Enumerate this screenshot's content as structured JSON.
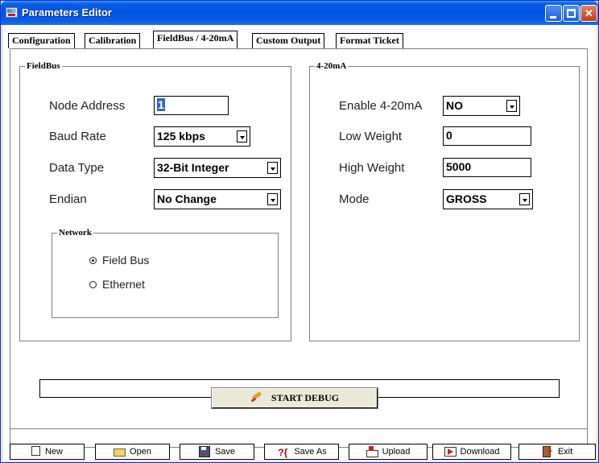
{
  "window": {
    "title": "Parameters Editor",
    "controls": {
      "minimize": "",
      "maximize": "",
      "close": "✕"
    }
  },
  "tabs": [
    {
      "label": "Configuration",
      "mnemonic_index": 3
    },
    {
      "label": "Calibration",
      "mnemonic_index": 6
    },
    {
      "label": "FieldBus / 4-20mA",
      "active": true
    },
    {
      "label": "Custom Output"
    },
    {
      "label": "Format Ticket"
    }
  ],
  "fieldbus": {
    "group_label": "FieldBus",
    "node_address": {
      "label": "Node Address",
      "value": "1"
    },
    "baud_rate": {
      "label": "Baud Rate",
      "value": "125 kbps"
    },
    "data_type": {
      "label": "Data Type",
      "value": "32-Bit Integer"
    },
    "endian": {
      "label": "Endian",
      "value": "No Change"
    },
    "network": {
      "group_label": "Network",
      "options": [
        {
          "label": "Field Bus",
          "selected": true
        },
        {
          "label": "Ethernet",
          "selected": false
        }
      ]
    }
  },
  "analog": {
    "group_label": "4-20mA",
    "enable": {
      "label": "Enable 4-20mA",
      "value": "NO"
    },
    "low_weight": {
      "label": "Low Weight",
      "value": "0"
    },
    "high_weight": {
      "label": "High Weight",
      "value": "5000"
    },
    "mode": {
      "label": "Mode",
      "value": "GROSS"
    }
  },
  "status_field": {
    "value": ""
  },
  "debug_button": {
    "label": "START DEBUG",
    "icon": "debug-icon"
  },
  "bottom_buttons": [
    {
      "label": "New",
      "icon": "new-file-icon"
    },
    {
      "label": "Open",
      "icon": "open-folder-icon"
    },
    {
      "label": "Save",
      "icon": "save-icon"
    },
    {
      "label": "Save As",
      "icon": "save-as-icon"
    },
    {
      "label": "Upload",
      "icon": "upload-icon"
    },
    {
      "label": "Download",
      "icon": "download-icon"
    },
    {
      "label": "Exit",
      "icon": "exit-icon"
    }
  ]
}
